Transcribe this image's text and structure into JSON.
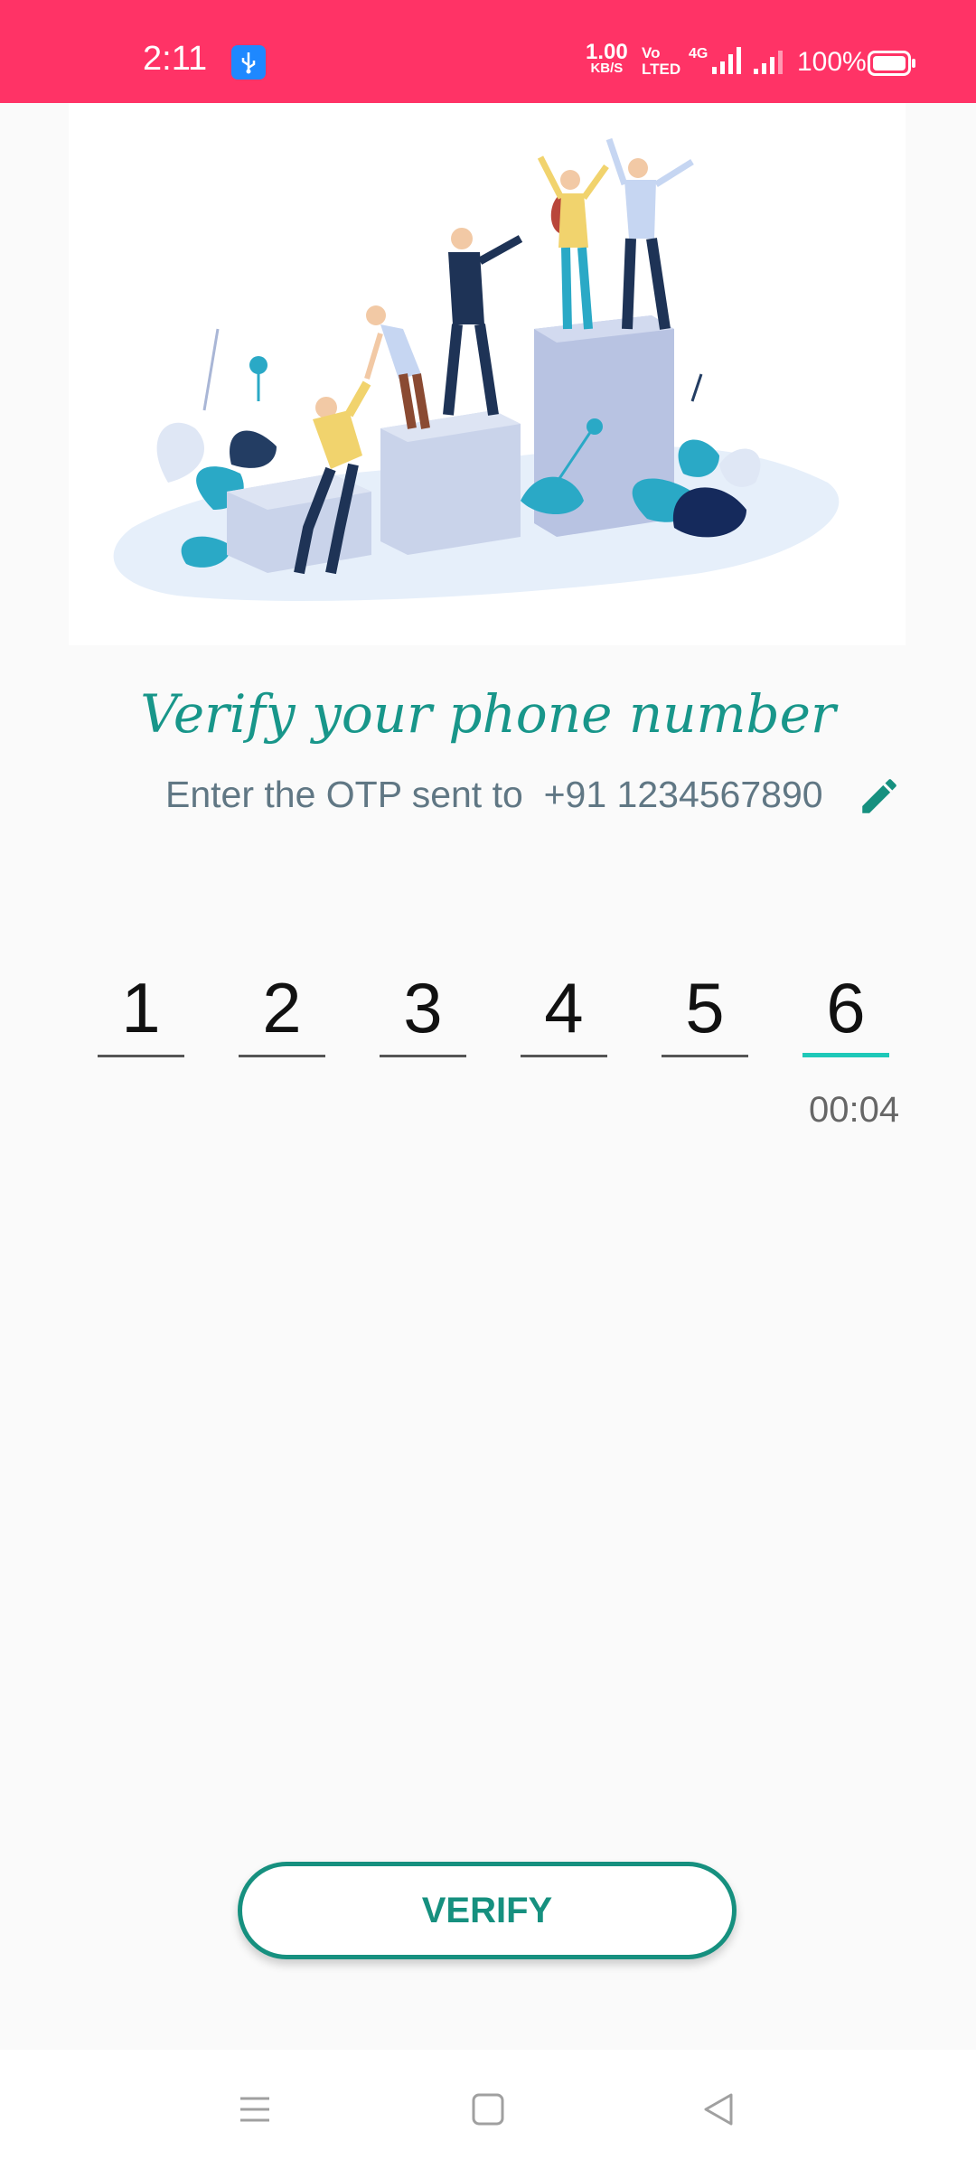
{
  "status_bar": {
    "time": "2:11",
    "net_rate": "1.00",
    "net_rate_unit": "KB/S",
    "volte_top": "Vo",
    "volte_bottom": "LTED",
    "network_type": "4G",
    "battery_percent": "100%",
    "bg_color": "#ff3366"
  },
  "hero": {
    "illustration": "people-climbing-podium-illustration"
  },
  "verify": {
    "title": "Verify your phone number",
    "subtitle_prefix": "Enter the OTP sent to ",
    "phone": "+91 1234567890"
  },
  "otp": {
    "digits": [
      "1",
      "2",
      "3",
      "4",
      "5",
      "6"
    ],
    "timer": "00:04"
  },
  "actions": {
    "verify_label": "VERIFY",
    "accent_color": "#16907f"
  },
  "nav": {
    "icons": [
      "menu-icon",
      "home-square-icon",
      "back-triangle-icon"
    ]
  }
}
